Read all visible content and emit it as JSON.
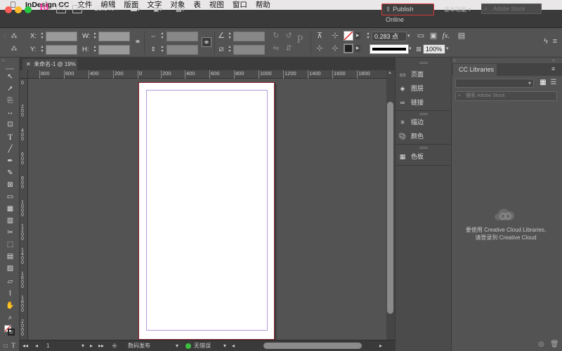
{
  "menubar": {
    "app_name": "InDesign CC",
    "items": [
      "文件",
      "编辑",
      "版面",
      "文字",
      "对象",
      "表",
      "视图",
      "窗口",
      "帮助"
    ]
  },
  "appbar": {
    "logo": "Id",
    "br_label": "Br",
    "st_label": "St",
    "zoom": "18.9%",
    "publish_label": "Publish Online",
    "workspace": "基本功能",
    "stock_placeholder": "Adobe Stock"
  },
  "control": {
    "x_label": "X:",
    "y_label": "Y:",
    "w_label": "W:",
    "h_label": "H:",
    "stroke_weight": "0.283 点",
    "opacity": "100%"
  },
  "document": {
    "tab_title": "未命名-1 @ 19%",
    "ruler_h": [
      "800",
      "600",
      "400",
      "200",
      "0",
      "200",
      "400",
      "600",
      "800",
      "1000",
      "1200",
      "1400",
      "1600",
      "1800"
    ],
    "ruler_v": [
      "0",
      "2 0 0",
      "4 0 0",
      "6 0 0",
      "8 0 0",
      "1 0 0 0",
      "1 2 0 0",
      "1 4 0 0",
      "1 6 0 0",
      "1 8 0 0",
      "2 0 0 0"
    ]
  },
  "status": {
    "page": "1",
    "profile": "数码发布",
    "errors": "无错误"
  },
  "panels": {
    "items": [
      {
        "label": "页面",
        "icon": "pages-icon"
      },
      {
        "label": "图层",
        "icon": "layers-icon"
      },
      {
        "label": "链接",
        "icon": "links-icon"
      },
      {
        "label": "描边",
        "icon": "stroke-icon"
      },
      {
        "label": "颜色",
        "icon": "color-icon"
      },
      {
        "label": "色板",
        "icon": "swatches-icon"
      }
    ]
  },
  "libraries": {
    "tab": "CC Libraries",
    "search_placeholder": "搜索 Adobe Stock",
    "message_line1": "要使用 Creative Cloud Libraries,",
    "message_line2": "请登录到 Creative Cloud"
  },
  "colors": {
    "accent_pink": "#ff3ba5",
    "publish_border": "#d9383a",
    "page_border": "#8b1a2a",
    "margin_guide": "#b39adc"
  }
}
